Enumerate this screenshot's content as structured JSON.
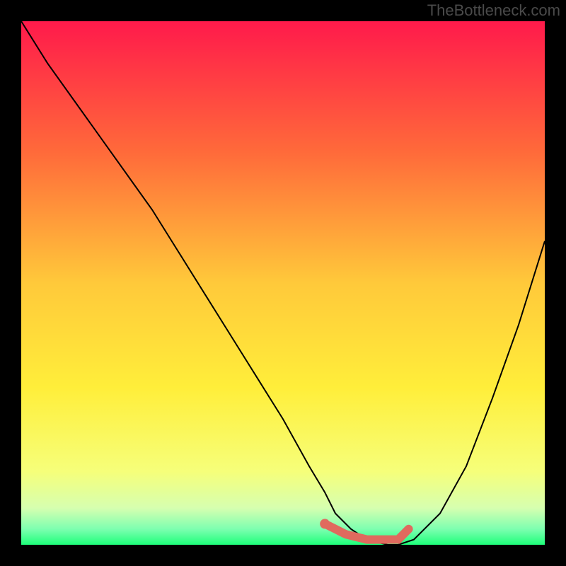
{
  "attribution": "TheBottleneck.com",
  "chart_data": {
    "type": "line",
    "title": "",
    "xlabel": "",
    "ylabel": "",
    "xlim": [
      0,
      100
    ],
    "ylim": [
      0,
      100
    ],
    "grid": false,
    "gradient_stops": [
      {
        "pct": 0,
        "color": "#ff1a4b"
      },
      {
        "pct": 25,
        "color": "#ff6a3a"
      },
      {
        "pct": 50,
        "color": "#ffc93a"
      },
      {
        "pct": 70,
        "color": "#ffee3a"
      },
      {
        "pct": 86,
        "color": "#f6ff7a"
      },
      {
        "pct": 93,
        "color": "#d6ffb0"
      },
      {
        "pct": 97,
        "color": "#7dffb0"
      },
      {
        "pct": 100,
        "color": "#1eff7a"
      }
    ],
    "series": [
      {
        "name": "bottleneck-curve",
        "color": "#000000",
        "width": 2,
        "x": [
          0,
          5,
          10,
          15,
          20,
          25,
          30,
          35,
          40,
          45,
          50,
          55,
          58,
          60,
          63,
          66,
          70,
          72,
          75,
          80,
          85,
          90,
          95,
          100
        ],
        "values": [
          100,
          92,
          85,
          78,
          71,
          64,
          56,
          48,
          40,
          32,
          24,
          15,
          10,
          6,
          3,
          1,
          0,
          0,
          1,
          6,
          15,
          28,
          42,
          58
        ]
      }
    ],
    "highlight_segment": {
      "name": "optimal-range",
      "color": "#e06a5e",
      "width": 12,
      "x": [
        58,
        60,
        62,
        64,
        66,
        68,
        70,
        72,
        73,
        74
      ],
      "values": [
        4,
        3,
        2,
        1.5,
        1,
        1,
        1,
        1,
        2,
        3
      ]
    },
    "highlight_dot": {
      "name": "current-point",
      "color": "#e06a5e",
      "radius": 7,
      "x": 58,
      "value": 4
    }
  }
}
